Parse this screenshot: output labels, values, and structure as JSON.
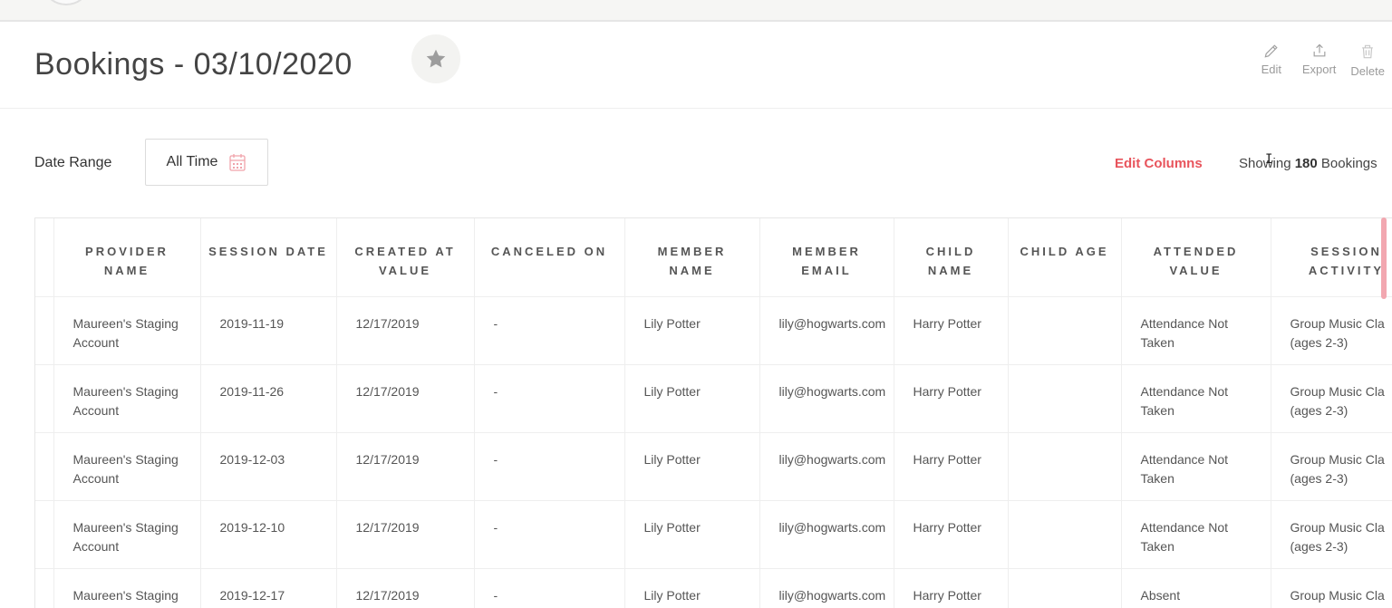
{
  "header": {
    "title": "Bookings - 03/10/2020",
    "actions": [
      {
        "label": "Edit",
        "icon": "pencil-icon"
      },
      {
        "label": "Export",
        "icon": "export-icon"
      },
      {
        "label": "Delete",
        "icon": "trash-icon"
      }
    ]
  },
  "filters": {
    "date_range_label": "Date Range",
    "date_range_value": "All Time",
    "edit_columns": "Edit Columns",
    "showing_prefix": "Showing",
    "showing_count": "180",
    "showing_suffix": "Bookings"
  },
  "colors": {
    "accent": "#e8545c",
    "scroll_thumb": "#f2a7b0",
    "muted": "#9a9a9a"
  },
  "table": {
    "columns": [
      "PROVIDER NAME",
      "SESSION DATE",
      "CREATED AT VALUE",
      "CANCELED ON",
      "MEMBER NAME",
      "MEMBER EMAIL",
      "CHILD NAME",
      "CHILD AGE",
      "ATTENDED VALUE",
      "SESSION ACTIVITY"
    ],
    "rows": [
      [
        "Maureen's Staging Account",
        "2019-11-19",
        "12/17/2019",
        "-",
        "Lily Potter",
        "lily@hogwarts.com",
        "Harry Potter",
        "",
        "Attendance Not Taken",
        "Group Music Cla (ages 2-3)"
      ],
      [
        "Maureen's Staging Account",
        "2019-11-26",
        "12/17/2019",
        "-",
        "Lily Potter",
        "lily@hogwarts.com",
        "Harry Potter",
        "",
        "Attendance Not Taken",
        "Group Music Cla (ages 2-3)"
      ],
      [
        "Maureen's Staging Account",
        "2019-12-03",
        "12/17/2019",
        "-",
        "Lily Potter",
        "lily@hogwarts.com",
        "Harry Potter",
        "",
        "Attendance Not Taken",
        "Group Music Cla (ages 2-3)"
      ],
      [
        "Maureen's Staging Account",
        "2019-12-10",
        "12/17/2019",
        "-",
        "Lily Potter",
        "lily@hogwarts.com",
        "Harry Potter",
        "",
        "Attendance Not Taken",
        "Group Music Cla (ages 2-3)"
      ],
      [
        "Maureen's Staging",
        "2019-12-17",
        "12/17/2019",
        "-",
        "Lily Potter",
        "lily@hogwarts.com",
        "Harry Potter",
        "",
        "Absent",
        "Group Music Cla"
      ]
    ]
  }
}
